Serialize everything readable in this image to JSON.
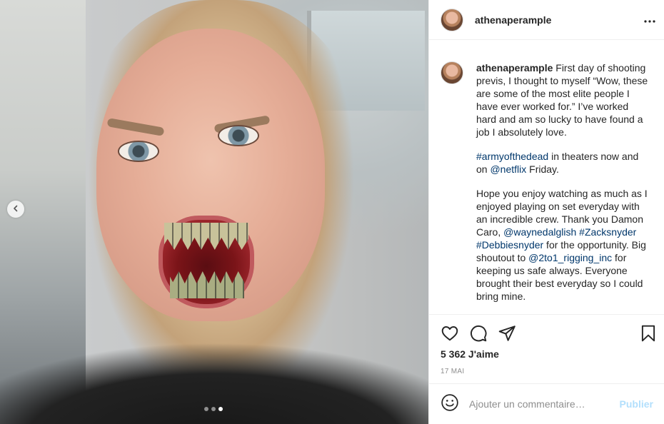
{
  "post": {
    "username": "athenaperample",
    "caption_paragraphs": [
      {
        "text": "First day of shooting previs, I thought to myself “Wow, these are some of the most elite people I have ever worked for.” I’ve worked hard and am so lucky to have found a job I absolutely love."
      }
    ],
    "p2": {
      "hashtag": "#armyofthedead",
      "mid": " in theaters now and on ",
      "mention": "@netflix",
      "end": " Friday."
    },
    "p3": {
      "start": "Hope you enjoy watching as much as I enjoyed playing on set everyday with an incredible crew. Thank you Damon Caro, ",
      "mention1": "@waynedalglish",
      "space1": " ",
      "hashtag1": "#Zacksnyder",
      "space2": " ",
      "hashtag2": "#Debbiesnyder",
      "mid": " for the opportunity. Big shoutout to ",
      "mention2": "@2to1_rigging_inc",
      "end": " for keeping us safe always. Everyone brought their best everyday so I could bring mine."
    },
    "likes": "5 362 J'aime",
    "date": "17 MAI",
    "comment_placeholder": "Ajouter un commentaire…",
    "publish_label": "Publier",
    "carousel": {
      "count": 3,
      "active_index": 2
    }
  },
  "icons": {
    "more": "more-options-icon",
    "like": "heart-icon",
    "comment": "comment-icon",
    "share": "share-icon",
    "save": "bookmark-icon",
    "emoji": "emoji-icon",
    "prev": "chevron-left-icon"
  },
  "colors": {
    "link": "#00376b",
    "publish_disabled": "#b2dffc",
    "text": "#262626",
    "muted": "#8e8e8e"
  }
}
